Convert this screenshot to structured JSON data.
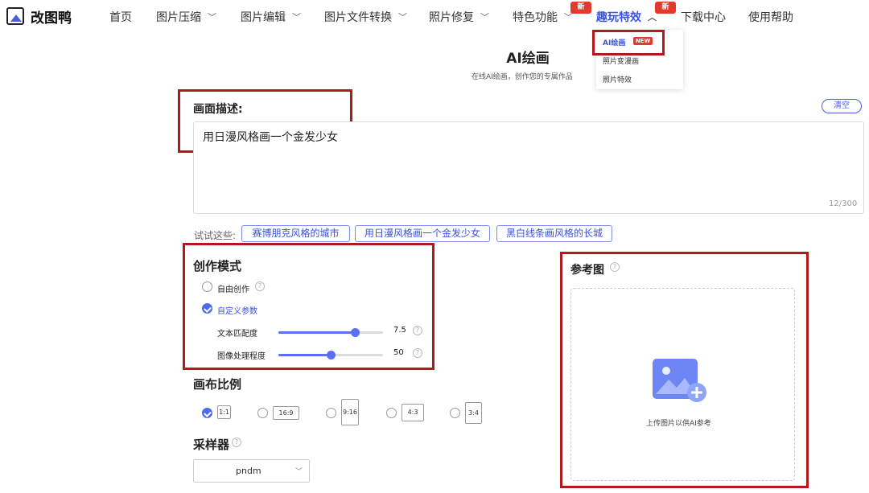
{
  "header": {
    "logo_text": "改图鸭",
    "nav": [
      {
        "label": "首页",
        "chev": false
      },
      {
        "label": "图片压缩",
        "chev": true
      },
      {
        "label": "图片编辑",
        "chev": true
      },
      {
        "label": "图片文件转换",
        "chev": true
      },
      {
        "label": "照片修复",
        "chev": true
      },
      {
        "label": "特色功能",
        "chev": true,
        "badge": "新"
      },
      {
        "label": "趣玩特效",
        "chev": true,
        "badge": "新",
        "active": true
      },
      {
        "label": "下载中心",
        "chev": false
      },
      {
        "label": "使用帮助",
        "chev": false
      }
    ]
  },
  "dropdown": {
    "items": [
      "AI绘画",
      "照片变漫画",
      "照片特效"
    ],
    "new_badge": "NEW"
  },
  "page": {
    "title": "AI绘画",
    "subtitle": "在线AI绘画，创作您的专属作品"
  },
  "description": {
    "label": "画面描述:",
    "clear_label": "清空",
    "text": "用日漫风格画一个金发少女",
    "char_count": "12/300"
  },
  "try": {
    "label": "试试这些:",
    "chips": [
      "赛博朋克风格的城市",
      "用日漫风格画一个金发少女",
      "黑白线条画风格的长城"
    ]
  },
  "mode": {
    "label": "创作模式",
    "options": [
      {
        "label": "自由创作",
        "selected": false
      },
      {
        "label": "自定义参数",
        "selected": true
      }
    ],
    "sliders": [
      {
        "label": "文本匹配度",
        "value": "7.5",
        "fraction": 0.73
      },
      {
        "label": "图像处理程度",
        "value": "50",
        "fraction": 0.5
      }
    ]
  },
  "canvas": {
    "label": "画布比例",
    "ratios": [
      {
        "label": "1:1",
        "selected": true
      },
      {
        "label": "16:9",
        "selected": false
      },
      {
        "label": "9:16",
        "selected": false
      },
      {
        "label": "4:3",
        "selected": false
      },
      {
        "label": "3:4",
        "selected": false
      }
    ]
  },
  "sampler": {
    "label": "采样器",
    "value": "pndm"
  },
  "reference": {
    "label": "参考图",
    "upload_text": "上传图片以供AI参考"
  },
  "colors": {
    "accent": "#4b6cf0",
    "highlight_border": "#b01a1a",
    "new_badge": "#e23b2e"
  }
}
